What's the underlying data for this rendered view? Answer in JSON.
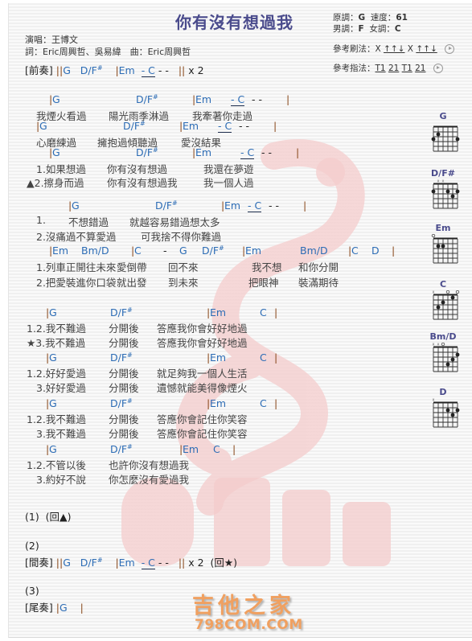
{
  "song": {
    "title": "你有沒有想過我",
    "singer": "演唱：王博文",
    "credits": "詞：Eric周興哲、吳易緯　曲：Eric周興哲"
  },
  "keys": {
    "original_label": "原調：",
    "original": "G",
    "tempo_label": "速度：",
    "tempo": "61",
    "male_label": "男調：",
    "male": "F",
    "female_label": "女調：",
    "female": "C",
    "strum_label": "參考刷法：",
    "strum_pattern": [
      "X",
      "↑↑↓",
      "X",
      "↑↑↓"
    ],
    "pick_label": "參考指法：",
    "pick_pattern": [
      "T1",
      "21",
      "T1",
      "21"
    ],
    "play_icon": "play-circle-icon"
  },
  "intro": {
    "label": "[前奏]",
    "open": "||",
    "chords": [
      "G",
      "D/F",
      "#",
      "|",
      "Em",
      "- C",
      "- -",
      "||",
      "x 2"
    ]
  },
  "sections": {
    "v1": {
      "c1": [
        "|",
        "G",
        "D/F",
        "#",
        "|",
        "Em",
        "- C",
        "- -",
        "|"
      ],
      "l1": [
        "我煙火看過",
        "陽光雨季淋過",
        "我牽著你走過"
      ],
      "c2": [
        "|",
        "G",
        "D/F",
        "#",
        "|",
        "Em",
        "- C",
        "- -",
        "|"
      ],
      "l2": [
        "心磨練過",
        "擁抱過傾聽過",
        "愛沒結果"
      ],
      "c3": [
        "|",
        "G",
        "D/F",
        "#",
        "|",
        "Em",
        "- C",
        "- -",
        "|"
      ],
      "l3a": [
        "1.如果想過",
        "你有沒有想過",
        "我還在夢遊"
      ],
      "l3b": [
        "▲2.擦身而過",
        "你有沒有想過我",
        "我一個人過"
      ],
      "c4": [
        "|",
        "G",
        "D/F",
        "#",
        "|",
        "Em",
        "- C",
        "- -",
        "|"
      ],
      "l4a": [
        "1.",
        "不想錯過",
        "就越容易錯過想太多"
      ],
      "l4b": [
        "2.沒痛過不算愛過",
        "可我捨不得你難過"
      ]
    },
    "pre": {
      "c": [
        "|",
        "Em",
        "Bm/D",
        "|",
        "C",
        "-",
        "G",
        "D/F",
        "#",
        "|",
        "Em",
        "Bm/D",
        "|",
        "C",
        "D",
        "|"
      ],
      "la": [
        "1.列車正開往未來",
        "愛倒帶",
        "回不來",
        "我不想",
        "和你分開"
      ],
      "lb": [
        "2.把愛裝進你口袋",
        "就出發",
        "到未來",
        "把眼神",
        "裝滿期待"
      ]
    },
    "chorus": {
      "c1": [
        "|",
        "G",
        "D/F",
        "#",
        "|",
        "Em",
        "C",
        "|"
      ],
      "l1a": [
        "1.2.我不難過",
        "分開後",
        "答應我你會好好地過"
      ],
      "l1b": [
        "★3.我不難過",
        "分開後",
        "答應我你會好好地過"
      ],
      "c2": [
        "|",
        "G",
        "D/F",
        "#",
        "|",
        "Em",
        "C",
        "|"
      ],
      "l2a": [
        "1.2.好好愛過",
        "分開後",
        "就足夠我一個人生活"
      ],
      "l2b": [
        "3.好好愛過",
        "分開後",
        "遺憾就能美得像煙火"
      ],
      "c3": [
        "|",
        "G",
        "D/F",
        "#",
        "|",
        "Em",
        "C",
        "|"
      ],
      "l3a": [
        "1.2.我不難過",
        "分開後",
        "答應你會記住你笑容"
      ],
      "l3b": [
        "3.我不難過",
        "分開後",
        "答應你會記住你笑容"
      ],
      "c4": [
        "|",
        "G",
        "D/F",
        "#",
        "|",
        "Em",
        "C",
        "|"
      ],
      "l4a": [
        "1.2.不管以後",
        "也許你沒有想過我"
      ],
      "l4b": [
        "3.約好不說",
        "你怎麼沒有愛過我"
      ]
    }
  },
  "ending": {
    "n1": "(1)",
    "n1_note": "(回▲)",
    "n2": "(2)",
    "interlude_label": "[間奏]",
    "interlude": [
      "||",
      "G",
      "D/F",
      "#",
      "|",
      "Em",
      "- C",
      "- -",
      "||",
      "x 2",
      "(回★)"
    ],
    "n3": "(3)",
    "outro_label": "[尾奏]",
    "outro": [
      "|",
      "G",
      "|"
    ]
  },
  "chord_diagrams": [
    {
      "name": "G"
    },
    {
      "name": "D/F#"
    },
    {
      "name": "Em"
    },
    {
      "name": "C"
    },
    {
      "name": "Bm/D"
    },
    {
      "name": "D"
    }
  ],
  "branding": {
    "logo_cn": "吉他之家",
    "logo_en": "798COM.COM",
    "brand_color": "#f0a060",
    "chord_color": "#2c6cb5",
    "title_color": "#4a4b8c",
    "watermark_color": "#f2c6c6"
  }
}
